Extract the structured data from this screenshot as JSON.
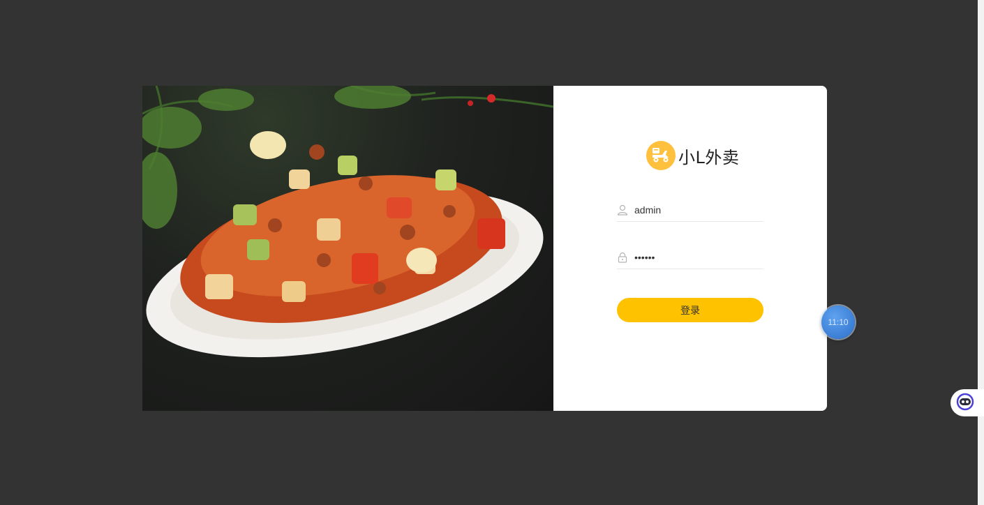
{
  "brand": {
    "name": "小L外卖",
    "logo_icon": "delivery-scooter-icon",
    "logo_color": "#ffc13d"
  },
  "form": {
    "username_value": "admin",
    "password_value": "123456",
    "login_label": "登录",
    "user_icon": "user-icon",
    "lock_icon": "lock-icon"
  },
  "overlay": {
    "timer_text": "11:10",
    "assistant_icon": "assistant-robot-icon"
  },
  "colors": {
    "background": "#333333",
    "accent": "#ffc200"
  }
}
